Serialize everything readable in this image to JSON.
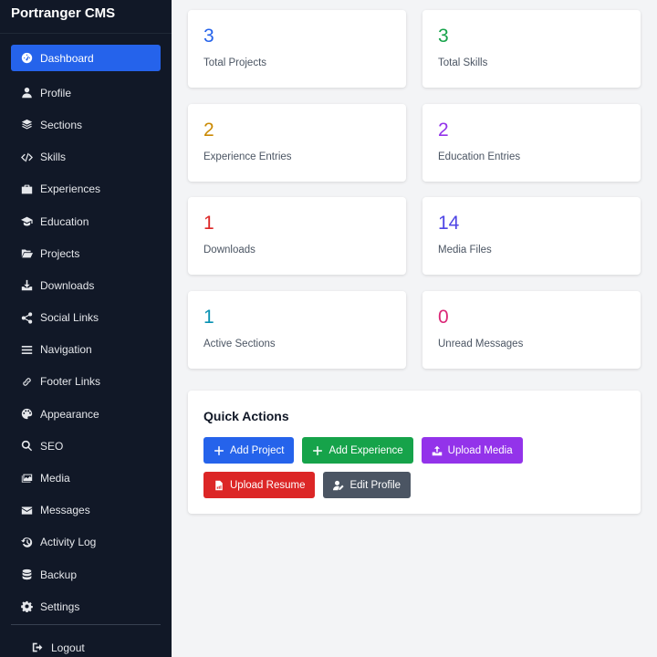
{
  "app": {
    "title": "Portranger CMS"
  },
  "sidebar": {
    "items": [
      {
        "label": "Dashboard",
        "icon": "gauge-icon",
        "active": true
      },
      {
        "label": "Profile",
        "icon": "user-icon"
      },
      {
        "label": "Sections",
        "icon": "layers-icon"
      },
      {
        "label": "Skills",
        "icon": "code-icon"
      },
      {
        "label": "Experiences",
        "icon": "briefcase-icon"
      },
      {
        "label": "Education",
        "icon": "graduation-cap-icon"
      },
      {
        "label": "Projects",
        "icon": "folder-open-icon"
      },
      {
        "label": "Downloads",
        "icon": "download-icon"
      },
      {
        "label": "Social Links",
        "icon": "share-icon"
      },
      {
        "label": "Navigation",
        "icon": "bars-icon"
      },
      {
        "label": "Footer Links",
        "icon": "link-icon"
      },
      {
        "label": "Appearance",
        "icon": "palette-icon"
      },
      {
        "label": "SEO",
        "icon": "search-icon"
      },
      {
        "label": "Media",
        "icon": "images-icon"
      },
      {
        "label": "Messages",
        "icon": "envelope-icon"
      },
      {
        "label": "Activity Log",
        "icon": "history-icon"
      },
      {
        "label": "Backup",
        "icon": "database-icon"
      },
      {
        "label": "Settings",
        "icon": "gear-icon"
      }
    ],
    "logout": {
      "label": "Logout",
      "icon": "sign-out-icon"
    }
  },
  "stats": [
    {
      "value": "3",
      "label": "Total Projects",
      "color": "#2563eb"
    },
    {
      "value": "3",
      "label": "Total Skills",
      "color": "#16a34a"
    },
    {
      "value": "2",
      "label": "Experience Entries",
      "color": "#ca8a04"
    },
    {
      "value": "2",
      "label": "Education Entries",
      "color": "#9333ea"
    },
    {
      "value": "1",
      "label": "Downloads",
      "color": "#dc2626"
    },
    {
      "value": "14",
      "label": "Media Files",
      "color": "#4f46e5"
    },
    {
      "value": "1",
      "label": "Active Sections",
      "color": "#0891b2"
    },
    {
      "value": "0",
      "label": "Unread Messages",
      "color": "#db2777"
    }
  ],
  "quick_actions": {
    "title": "Quick Actions",
    "buttons": [
      {
        "label": "Add Project",
        "color": "#2563eb",
        "icon": "plus-icon"
      },
      {
        "label": "Add Experience",
        "color": "#16a34a",
        "icon": "plus-icon"
      },
      {
        "label": "Upload Media",
        "color": "#9333ea",
        "icon": "upload-icon"
      },
      {
        "label": "Upload Resume",
        "color": "#dc2626",
        "icon": "file-pdf-icon"
      },
      {
        "label": "Edit Profile",
        "color": "#4b5563",
        "icon": "user-edit-icon"
      }
    ]
  }
}
